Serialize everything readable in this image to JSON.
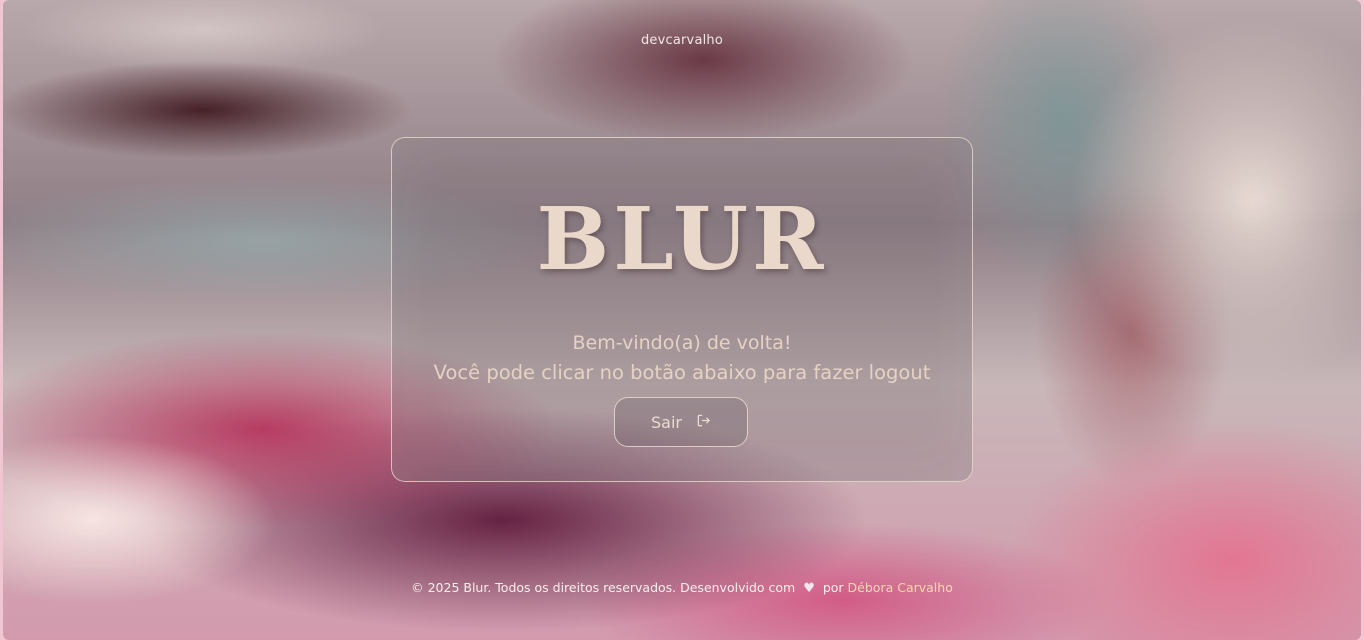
{
  "header": {
    "brand": "devcarvalho"
  },
  "card": {
    "logo": "BLUR",
    "welcome": "Bem-vindo(a) de volta!",
    "instruction": "Você pode clicar no botão abaixo para fazer logout",
    "logout_label": "Sair",
    "logout_icon": "logout-icon"
  },
  "footer": {
    "copyright": "© 2025 Blur. Todos os direitos reservados. Desenvolvido com",
    "heart_icon": "heart-icon",
    "by": "por",
    "author": "Débora Carvalho"
  },
  "colors": {
    "text": "#ead8cb",
    "author_link": "#f7d9ae",
    "border": "#f0e1d4"
  }
}
